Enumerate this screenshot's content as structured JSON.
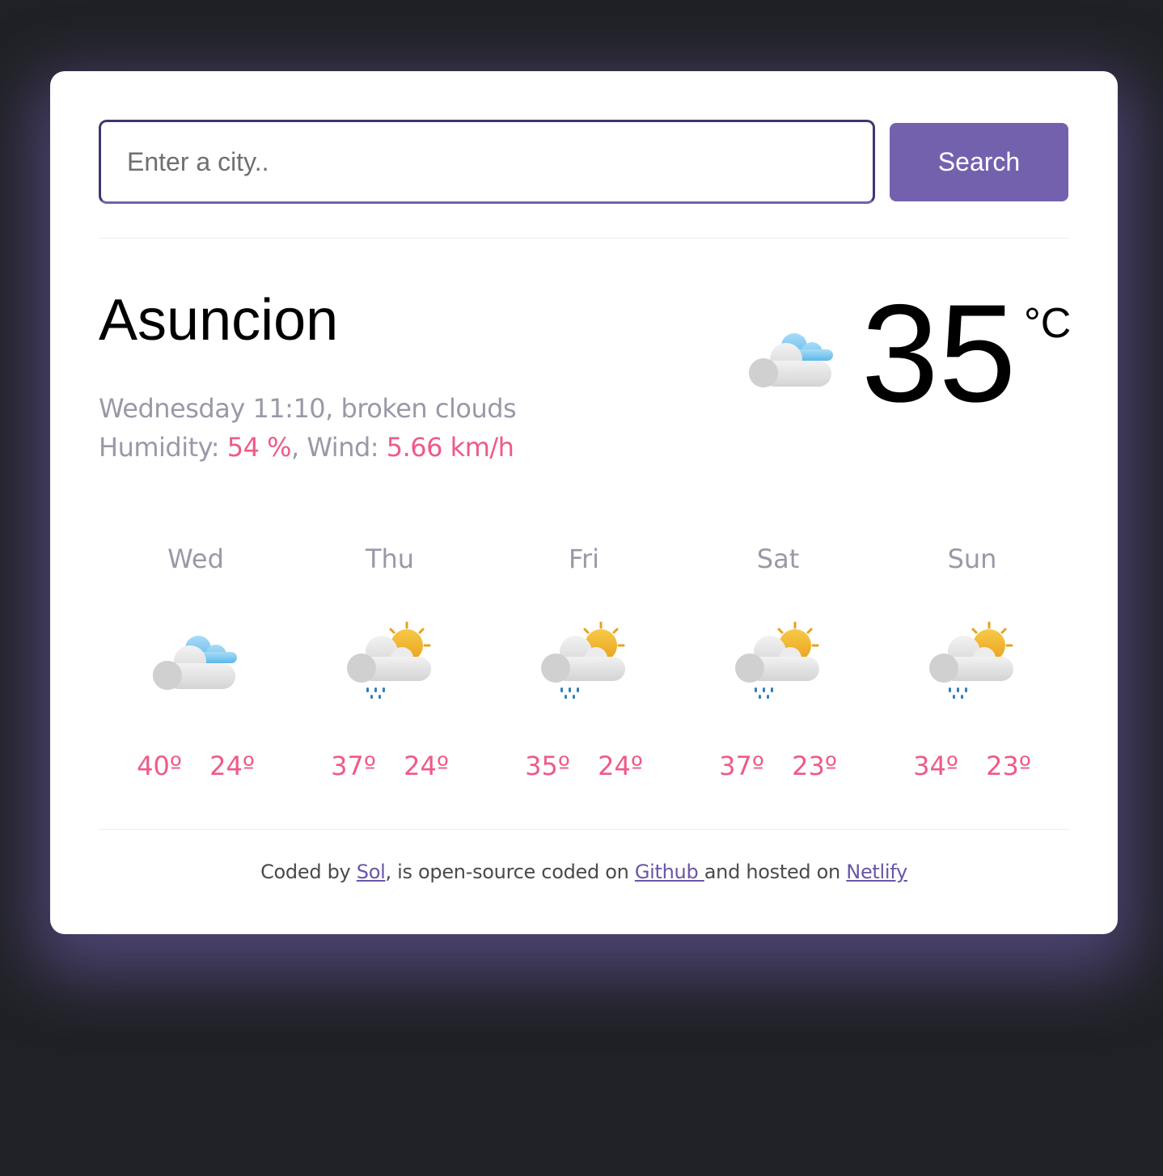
{
  "search": {
    "placeholder": "Enter a city..",
    "button_label": "Search"
  },
  "current": {
    "city": "Asuncion",
    "datetime": "Wednesday 11:10",
    "description": "broken clouds",
    "humidity_label": "Humidity:",
    "humidity_value": "54 %",
    "wind_label": "Wind:",
    "wind_value": "5.66 km/h",
    "temperature": "35",
    "unit": "°C",
    "icon": "broken-clouds-icon"
  },
  "forecast": [
    {
      "day": "Wed",
      "max": "40º",
      "min": "24º",
      "icon": "broken-clouds-icon"
    },
    {
      "day": "Thu",
      "max": "37º",
      "min": "24º",
      "icon": "sun-rain-cloud-icon"
    },
    {
      "day": "Fri",
      "max": "35º",
      "min": "24º",
      "icon": "sun-rain-cloud-icon"
    },
    {
      "day": "Sat",
      "max": "37º",
      "min": "23º",
      "icon": "sun-rain-cloud-icon"
    },
    {
      "day": "Sun",
      "max": "34º",
      "min": "23º",
      "icon": "sun-rain-cloud-icon"
    }
  ],
  "footer": {
    "prefix": "Coded by ",
    "author": "Sol",
    "middle": ", is open-source coded on ",
    "github": "Github ",
    "middle2": "and hosted on ",
    "netlify": "Netlify"
  },
  "colors": {
    "accent": "#7461ae",
    "highlight": "#ef5a86",
    "muted": "#9b98a7",
    "background": "#202126"
  }
}
